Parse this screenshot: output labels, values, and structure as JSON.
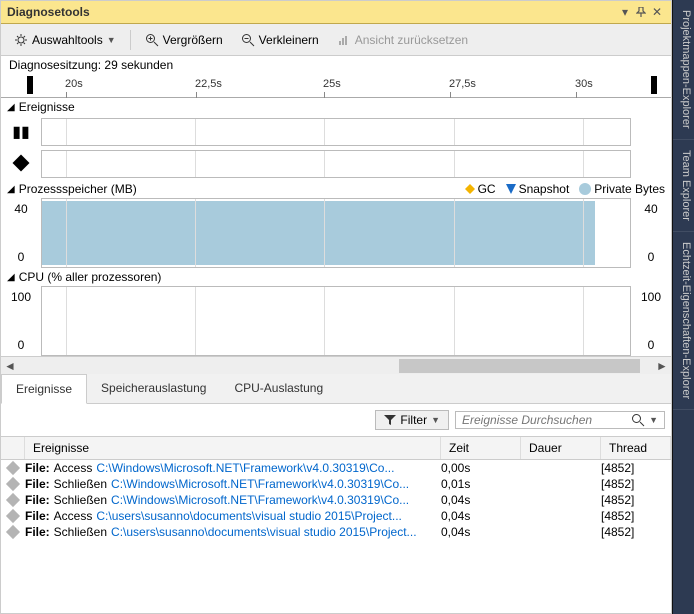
{
  "window": {
    "title": "Diagnosetools"
  },
  "toolbar": {
    "select_tools": "Auswahltools",
    "zoom_in": "Vergrößern",
    "zoom_out": "Verkleinern",
    "reset_view": "Ansicht zurücksetzen"
  },
  "session": {
    "label": "Diagnosesitzung: 29 sekunden"
  },
  "ruler": {
    "ticks": [
      "20s",
      "22,5s",
      "25s",
      "27,5s",
      "30s"
    ]
  },
  "sections": {
    "events": {
      "title": "Ereignisse"
    },
    "memory": {
      "title": "Prozessspeicher (MB)",
      "legend_gc": "GC",
      "legend_snapshot": "Snapshot",
      "legend_private": "Private Bytes"
    },
    "cpu": {
      "title": "CPU (% aller prozessoren)"
    }
  },
  "chart_data": [
    {
      "type": "area",
      "title": "Prozessspeicher (MB)",
      "ylabel": "MB",
      "ylim": [
        0,
        40
      ],
      "xlim_sec": [
        19,
        31
      ],
      "categories": [
        "20s",
        "22,5s",
        "25s",
        "27,5s",
        "30s"
      ],
      "series": [
        {
          "name": "Private Bytes",
          "values": [
            40,
            40,
            40,
            40,
            40
          ],
          "color": "#a8cbdc",
          "fill_to_x_sec": 30
        }
      ]
    },
    {
      "type": "line",
      "title": "CPU (% aller prozessoren)",
      "ylabel": "%",
      "ylim": [
        0,
        100
      ],
      "xlim_sec": [
        19,
        31
      ],
      "categories": [
        "20s",
        "22,5s",
        "25s",
        "27,5s",
        "30s"
      ],
      "series": [
        {
          "name": "CPU",
          "values": [
            0,
            0,
            0,
            0,
            0
          ]
        }
      ]
    }
  ],
  "axes": {
    "mem_top": "40",
    "mem_bottom": "0",
    "cpu_top": "100",
    "cpu_bottom": "0"
  },
  "tabs": {
    "events": "Ereignisse",
    "memory": "Speicherauslastung",
    "cpu": "CPU-Auslastung"
  },
  "filter": {
    "label": "Filter",
    "placeholder": "Ereignisse Durchsuchen"
  },
  "grid": {
    "headers": {
      "event": "Ereignisse",
      "time": "Zeit",
      "duration": "Dauer",
      "thread": "Thread"
    },
    "rows": [
      {
        "prefix": "File:",
        "action": "Access",
        "path": "C:\\Windows\\Microsoft.NET\\Framework\\v4.0.30319\\Co...",
        "time": "0,00s",
        "duration": "",
        "thread": "[4852]"
      },
      {
        "prefix": "File:",
        "action": "Schließen",
        "path": "C:\\Windows\\Microsoft.NET\\Framework\\v4.0.30319\\Co...",
        "time": "0,01s",
        "duration": "",
        "thread": "[4852]"
      },
      {
        "prefix": "File:",
        "action": "Schließen",
        "path": "C:\\Windows\\Microsoft.NET\\Framework\\v4.0.30319\\Co...",
        "time": "0,04s",
        "duration": "",
        "thread": "[4852]"
      },
      {
        "prefix": "File:",
        "action": "Access",
        "path": "C:\\users\\susanno\\documents\\visual studio 2015\\Project...",
        "time": "0,04s",
        "duration": "",
        "thread": "[4852]"
      },
      {
        "prefix": "File:",
        "action": "Schließen",
        "path": "C:\\users\\susanno\\documents\\visual studio 2015\\Project...",
        "time": "0,04s",
        "duration": "",
        "thread": "[4852]"
      }
    ]
  },
  "side_tabs": {
    "solution": "Projektmappen-Explorer",
    "team": "Team Explorer",
    "realtime": "Echtzeit-Eigenschaften-Explorer"
  }
}
